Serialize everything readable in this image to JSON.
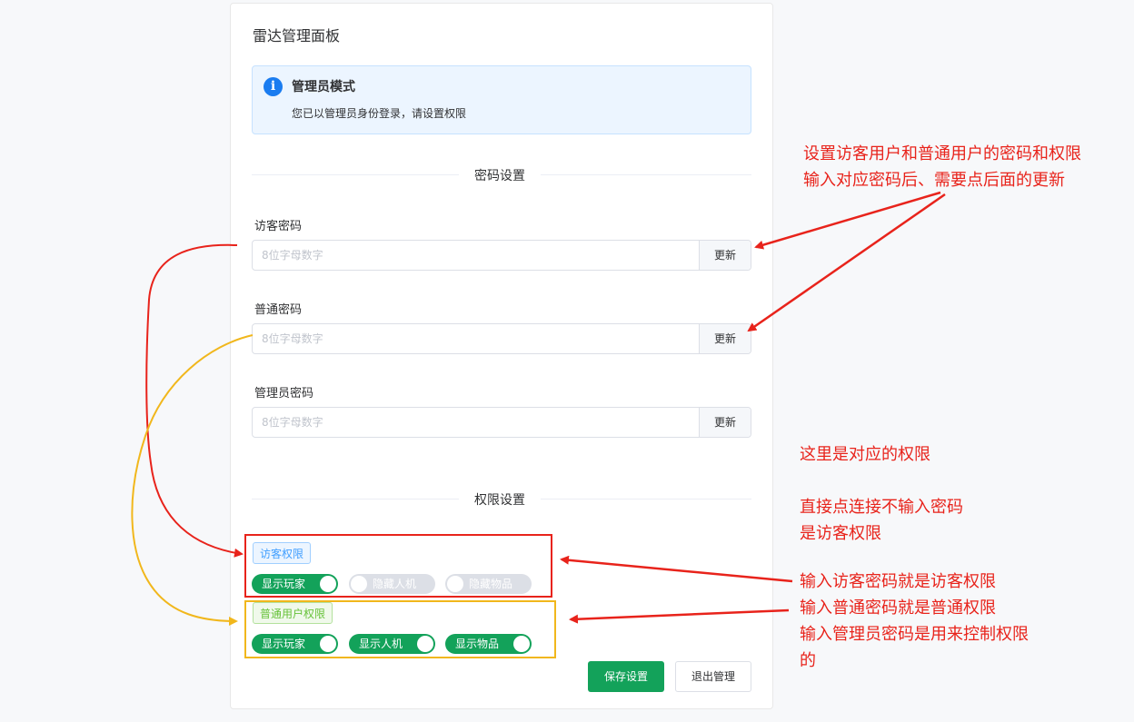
{
  "panel": {
    "title": "雷达管理面板",
    "alert": {
      "title": "管理员模式",
      "description": "您已以管理员身份登录，请设置权限"
    },
    "password_section": {
      "heading": "密码设置",
      "fields": [
        {
          "label": "访客密码",
          "placeholder": "8位字母数字",
          "button": "更新"
        },
        {
          "label": "普通密码",
          "placeholder": "8位字母数字",
          "button": "更新"
        },
        {
          "label": "管理员密码",
          "placeholder": "8位字母数字",
          "button": "更新"
        }
      ]
    },
    "permission_section": {
      "heading": "权限设置",
      "groups": [
        {
          "tag": "访客权限",
          "tag_color": "#409eff",
          "switches": [
            {
              "label": "显示玩家",
              "on": true
            },
            {
              "label": "隐藏人机",
              "on": false
            },
            {
              "label": "隐藏物品",
              "on": false
            }
          ]
        },
        {
          "tag": "普通用户权限",
          "tag_color": "#67c23a",
          "switches": [
            {
              "label": "显示玩家",
              "on": true
            },
            {
              "label": "显示人机",
              "on": true
            },
            {
              "label": "显示物品",
              "on": true
            }
          ]
        }
      ]
    },
    "buttons": {
      "save": "保存设置",
      "exit": "退出管理"
    }
  },
  "annotations": {
    "color": "#e8231b",
    "note_top": "设置访客用户和普通用户的密码和权限\n输入对应密码后、需要点后面的更新",
    "note_middle": "这里是对应的权限\n\n直接点连接不输入密码\n是访客权限",
    "note_bottom": "输入访客密码就是访客权限\n输入普通密码就是普通权限\n输入管理员密码是用来控制权限\n的"
  },
  "colors": {
    "primary": "#13a25a",
    "info": "#1a7cf0"
  }
}
